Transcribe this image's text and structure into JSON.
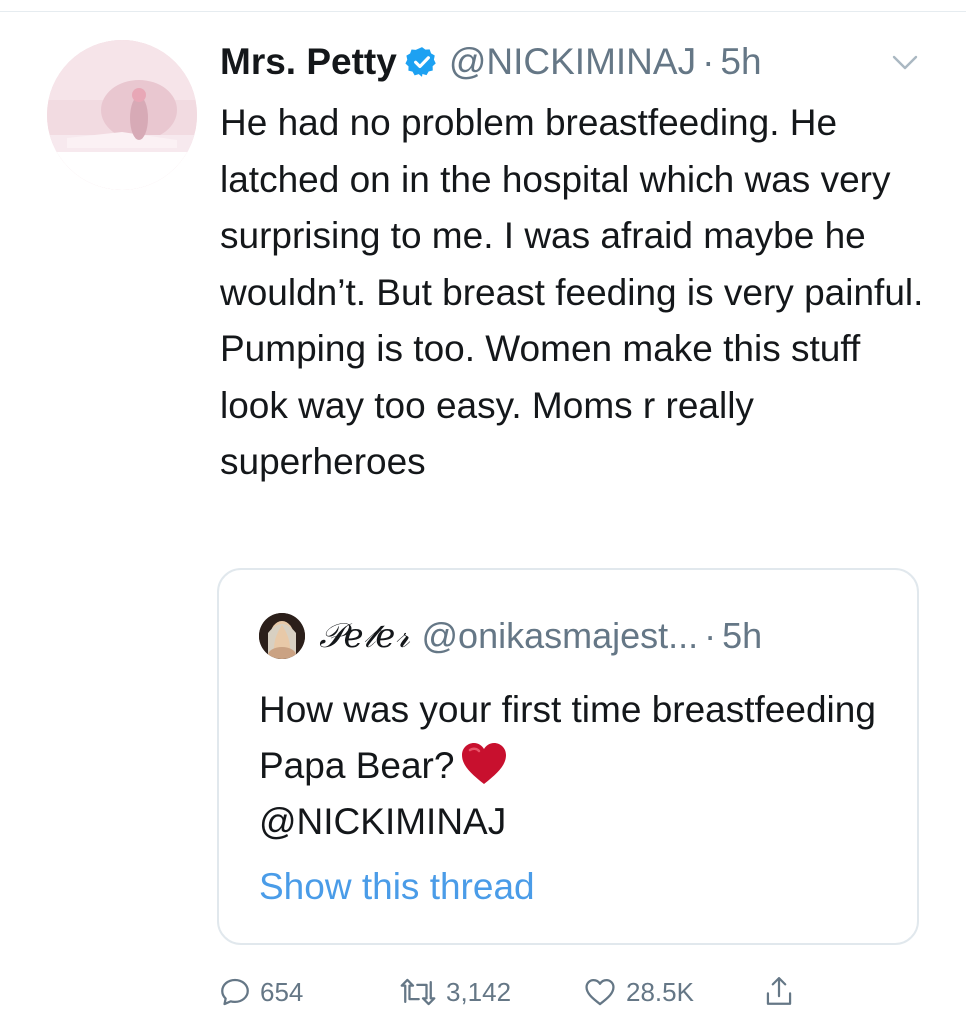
{
  "tweet": {
    "display_name": "Mrs. Petty",
    "handle": "@NICKIMINAJ",
    "separator": "·",
    "time": "5h",
    "verified": true,
    "text": "He had no problem breastfeeding. He latched on in the hospital which was very surprising to me. I was afraid maybe he wouldn’t. But breast feeding is very painful. Pumping is too. Women make this stuff look way too easy. Moms r really superheroes",
    "icons": {
      "verified": "verified-badge-icon",
      "menu": "chevron-down-icon"
    }
  },
  "quote": {
    "display_name": "𝒫𝑒𝓉𝑒𝓇",
    "handle": "@onikasmajest...",
    "separator": "·",
    "time": "5h",
    "text": "How was your first time breastfeeding Papa Bear?",
    "emoji": "red-heart",
    "mention": "@NICKIMINAJ",
    "show_thread": "Show this thread"
  },
  "actions": {
    "replies": "654",
    "retweets": "3,142",
    "likes": "28.5K",
    "icons": [
      "reply-icon",
      "retweet-icon",
      "like-heart-icon",
      "share-icon"
    ]
  },
  "colors": {
    "text": "#14171a",
    "secondary": "#657786",
    "link": "#4a9ce8",
    "verified": "#1da1f2",
    "border": "#e1e8ed"
  }
}
